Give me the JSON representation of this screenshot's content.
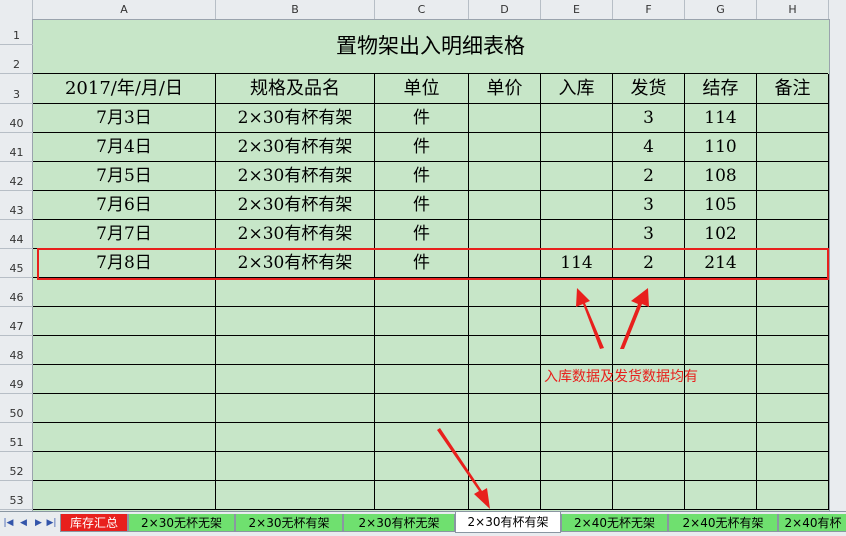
{
  "columns": [
    "A",
    "B",
    "C",
    "D",
    "E",
    "F",
    "G",
    "H"
  ],
  "title": "置物架出入明细表格",
  "header_rows": [
    "1",
    "2",
    "3"
  ],
  "headers": [
    "2017/年/月/日",
    "规格及品名",
    "单位",
    "单价",
    "入库",
    "发货",
    "结存",
    "备注"
  ],
  "rows": [
    {
      "num": "40",
      "cells": [
        "7月3日",
        "2×30有杯有架",
        "件",
        "",
        "",
        "3",
        "114",
        ""
      ]
    },
    {
      "num": "41",
      "cells": [
        "7月4日",
        "2×30有杯有架",
        "件",
        "",
        "",
        "4",
        "110",
        ""
      ]
    },
    {
      "num": "42",
      "cells": [
        "7月5日",
        "2×30有杯有架",
        "件",
        "",
        "",
        "2",
        "108",
        ""
      ]
    },
    {
      "num": "43",
      "cells": [
        "7月6日",
        "2×30有杯有架",
        "件",
        "",
        "",
        "3",
        "105",
        ""
      ]
    },
    {
      "num": "44",
      "cells": [
        "7月7日",
        "2×30有杯有架",
        "件",
        "",
        "",
        "3",
        "102",
        ""
      ]
    },
    {
      "num": "45",
      "cells": [
        "7月8日",
        "2×30有杯有架",
        "件",
        "",
        "114",
        "2",
        "214",
        ""
      ]
    },
    {
      "num": "46",
      "cells": [
        "",
        "",
        "",
        "",
        "",
        "",
        "",
        ""
      ]
    },
    {
      "num": "47",
      "cells": [
        "",
        "",
        "",
        "",
        "",
        "",
        "",
        ""
      ]
    },
    {
      "num": "48",
      "cells": [
        "",
        "",
        "",
        "",
        "",
        "",
        "",
        ""
      ]
    },
    {
      "num": "49",
      "cells": [
        "",
        "",
        "",
        "",
        "",
        "",
        "",
        ""
      ]
    },
    {
      "num": "50",
      "cells": [
        "",
        "",
        "",
        "",
        "",
        "",
        "",
        ""
      ]
    },
    {
      "num": "51",
      "cells": [
        "",
        "",
        "",
        "",
        "",
        "",
        "",
        ""
      ]
    },
    {
      "num": "52",
      "cells": [
        "",
        "",
        "",
        "",
        "",
        "",
        "",
        ""
      ]
    },
    {
      "num": "53",
      "cells": [
        "",
        "",
        "",
        "",
        "",
        "",
        "",
        ""
      ]
    }
  ],
  "annotation": "入库数据及发货数据均有",
  "sheet_tabs": [
    {
      "label": "库存汇总",
      "bg": "#e8201d",
      "fg": "#ffffff"
    },
    {
      "label": "2×30无杯无架",
      "bg": "#6fe06f",
      "fg": "#000000"
    },
    {
      "label": "2×30无杯有架",
      "bg": "#6fe06f",
      "fg": "#000000"
    },
    {
      "label": "2×30有杯无架",
      "bg": "#6fe06f",
      "fg": "#000000"
    },
    {
      "label": "2×30有杯有架",
      "bg": "#ffffff",
      "fg": "#000000",
      "active": true
    },
    {
      "label": "2×40无杯无架",
      "bg": "#6fe06f",
      "fg": "#000000"
    },
    {
      "label": "2×40无杯有架",
      "bg": "#6fe06f",
      "fg": "#000000"
    },
    {
      "label": "2×40有杯",
      "bg": "#6fe06f",
      "fg": "#000000"
    }
  ],
  "colors": {
    "accent_red": "#e8201d",
    "sheet_bg": "#c7e6c8",
    "tab_green": "#6fe06f"
  }
}
